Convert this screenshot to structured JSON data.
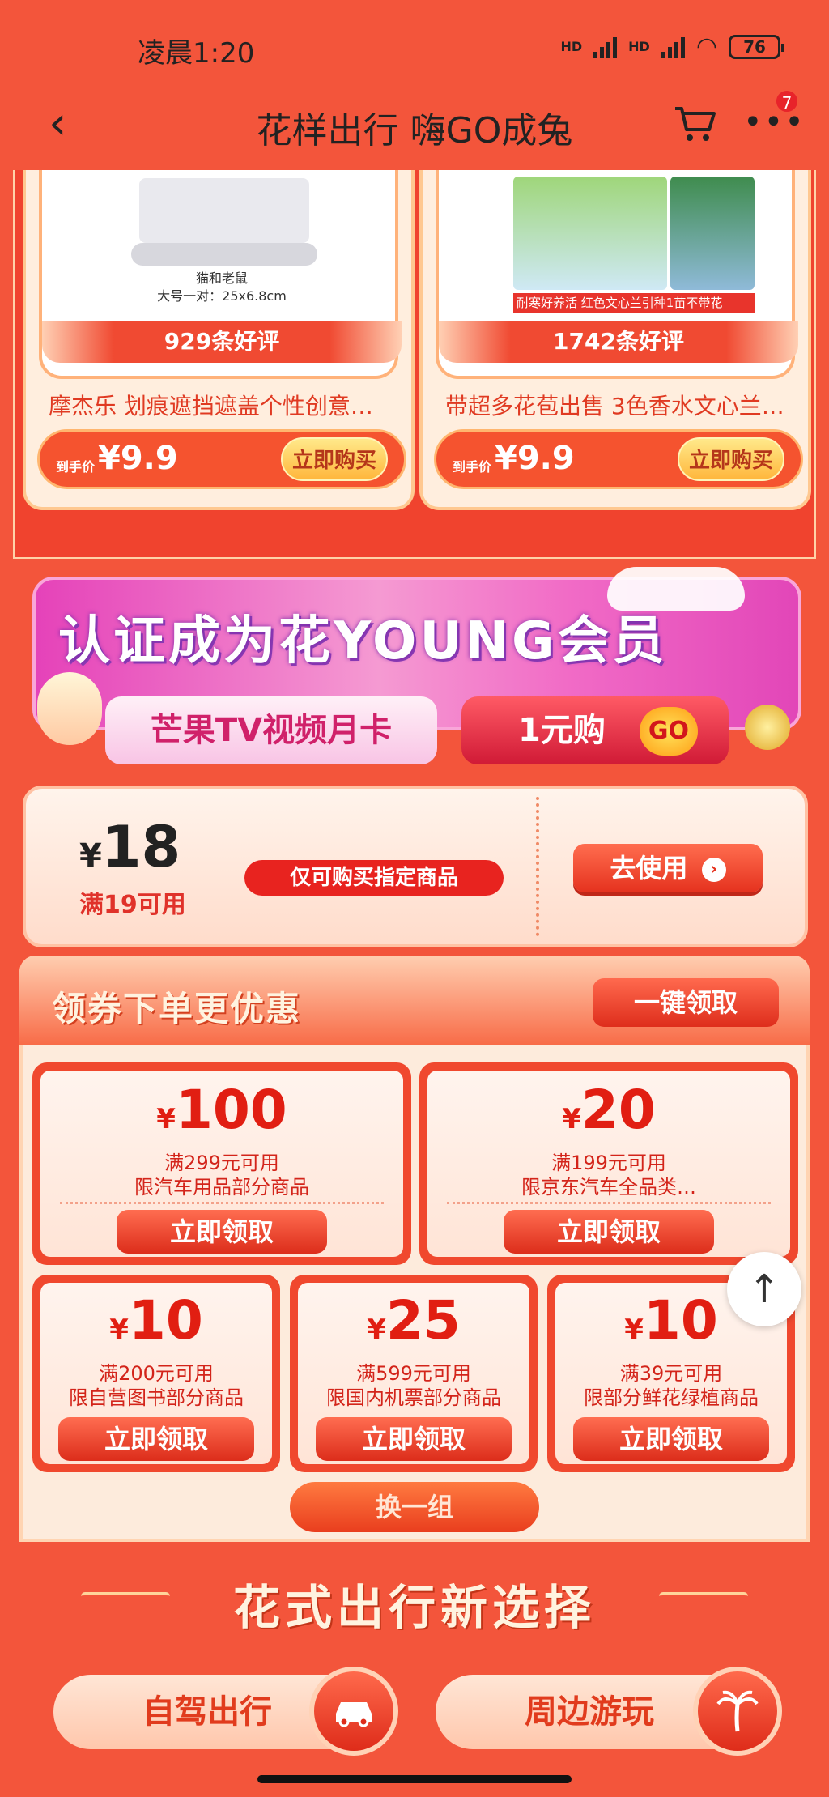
{
  "status_bar": {
    "time": "凌晨1:20",
    "signal1": "HD",
    "signal2": "HD",
    "battery": "76"
  },
  "nav": {
    "back_icon": "back-arrow-icon",
    "title": "花样出行 嗨GO成兔",
    "cart_icon": "cart-icon",
    "more_icon": "more-icon",
    "badge": "7"
  },
  "products": [
    {
      "img_caption1": "猫和老鼠",
      "img_caption2": "大号一对：25x6.8cm",
      "reviews": "929条好评",
      "name": "摩杰乐 划痕遮挡遮盖个性创意…",
      "price_label": "到手价",
      "price": "¥9.9",
      "buy": "立即购买"
    },
    {
      "img_caption1": "耐寒好养活",
      "img_caption2": "红色文心兰引种1苗不带花",
      "reviews": "1742条好评",
      "name": "带超多花苞出售 3色香水文心兰…",
      "price_label": "到手价",
      "price": "¥9.9",
      "buy": "立即购买"
    }
  ],
  "banner": {
    "title": "认证成为花YOUNG会员",
    "sub1": "芒果TV视频月卡",
    "sub2": "1元购",
    "go": "GO"
  },
  "coupon_main": {
    "yen": "¥",
    "amount": "18",
    "condition": "满19可用",
    "tag": "仅可购买指定商品",
    "use_btn": "去使用"
  },
  "coupon_section": {
    "title": "领券下单更优惠",
    "claim_all": "一键领取",
    "coupons": [
      {
        "yen": "¥",
        "amount": "100",
        "cond": "满299元可用",
        "scope": "限汽车用品部分商品",
        "btn": "立即领取"
      },
      {
        "yen": "¥",
        "amount": "20",
        "cond": "满199元可用",
        "scope": "限京东汽车全品类…",
        "btn": "立即领取"
      },
      {
        "yen": "¥",
        "amount": "10",
        "cond": "满200元可用",
        "scope": "限自营图书部分商品",
        "btn": "立即领取"
      },
      {
        "yen": "¥",
        "amount": "25",
        "cond": "满599元可用",
        "scope": "限国内机票部分商品",
        "btn": "立即领取"
      },
      {
        "yen": "¥",
        "amount": "10",
        "cond": "满39元可用",
        "scope": "限部分鲜花绿植商品",
        "btn": "立即领取"
      }
    ],
    "swap": "换一组"
  },
  "scroll_top_icon": "↑",
  "section2": {
    "title": "花式出行新选择",
    "cat1": "自驾出行",
    "cat1_icon": "car-icon",
    "cat2": "周边游玩",
    "cat2_icon": "palm-tree-icon"
  }
}
